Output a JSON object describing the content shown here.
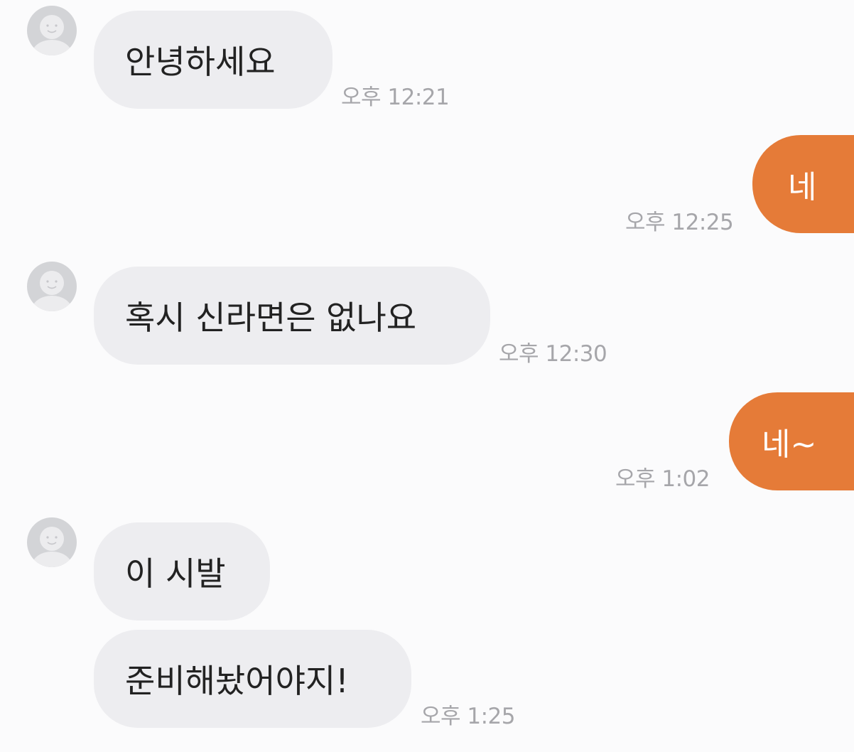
{
  "messages": [
    {
      "direction": "in",
      "text": "안녕하세요",
      "time": "오후 12:21"
    },
    {
      "direction": "out",
      "text": "네",
      "time": "오후 12:25"
    },
    {
      "direction": "in",
      "text": "혹시 신라면은 없나요",
      "time": "오후 12:30"
    },
    {
      "direction": "out",
      "text": "네~",
      "time": "오후 1:02"
    },
    {
      "direction": "in",
      "text": "이 시발",
      "time": ""
    },
    {
      "direction": "in",
      "text": "준비해놨어야지!",
      "time": "오후 1:25"
    }
  ],
  "colors": {
    "outgoing_bubble": "#e57b38",
    "incoming_bubble": "#ededf0",
    "timestamp": "#a6a6aa",
    "avatar": "#d3d4d7"
  },
  "icons": {
    "avatar": "default-profile-icon"
  }
}
